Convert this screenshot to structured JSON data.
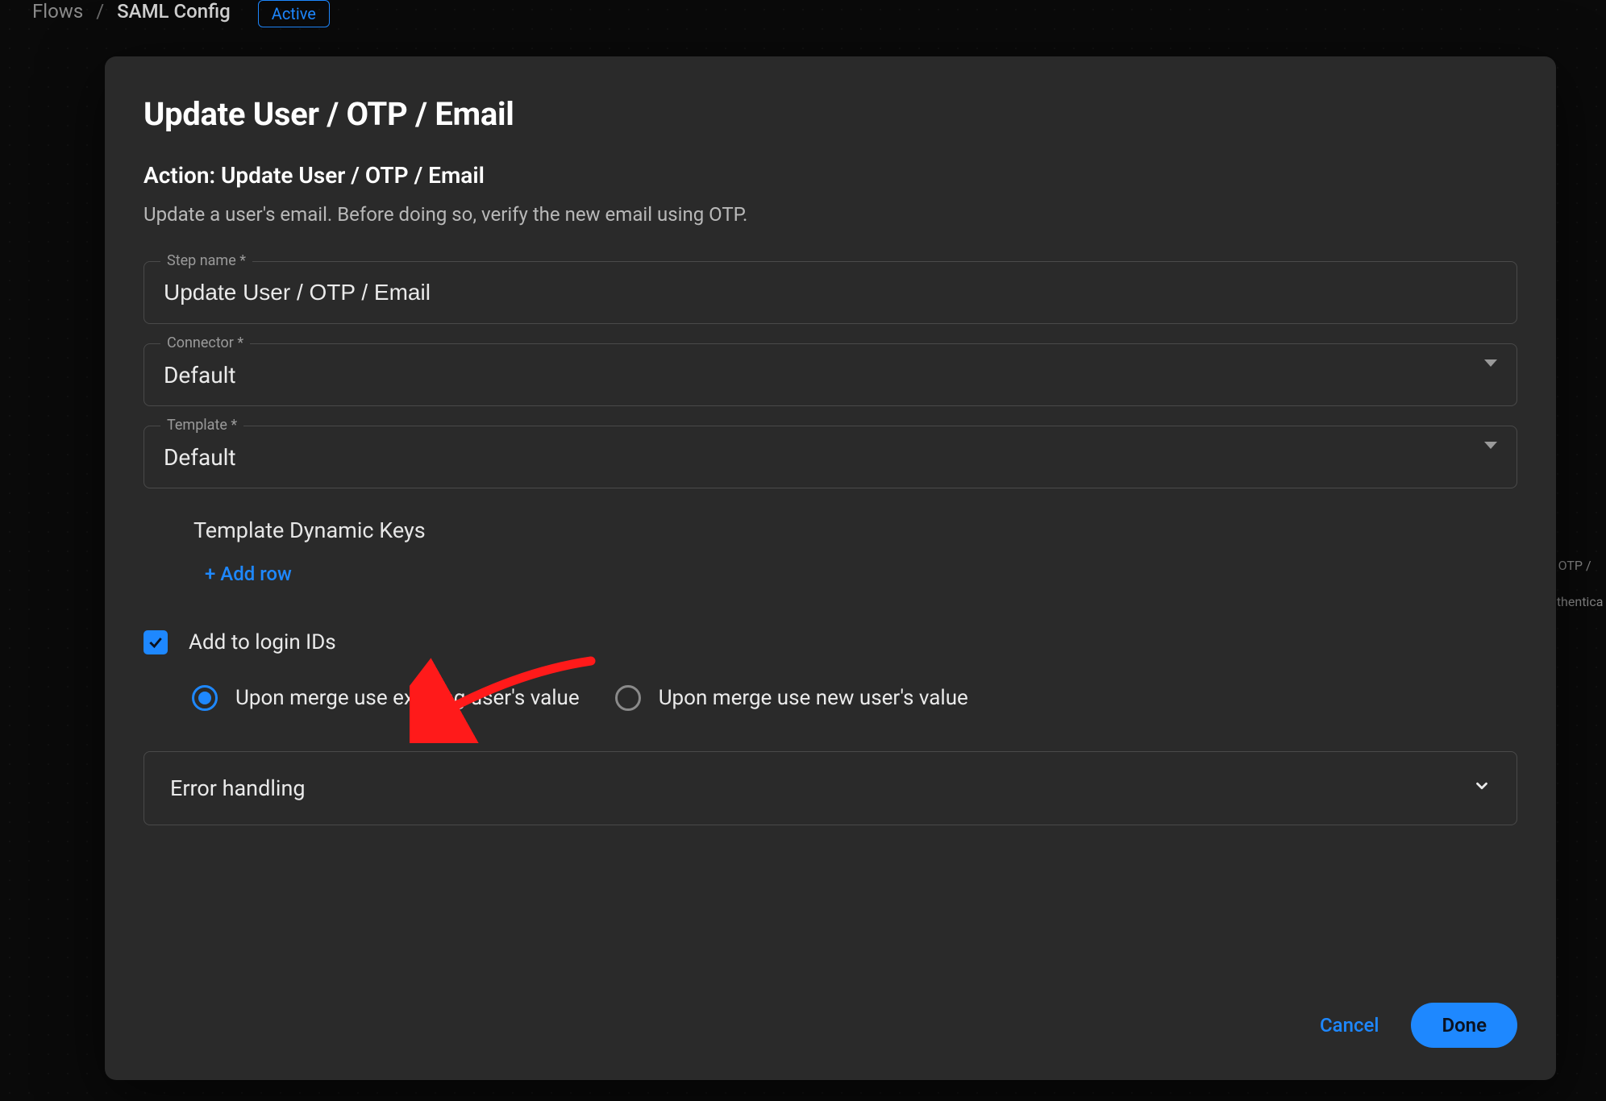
{
  "breadcrumb": {
    "root": "Flows",
    "current": "SAML Config",
    "badge": "Active"
  },
  "bg_hints": {
    "line1": "/ OTP /",
    "line2": "uthentica"
  },
  "modal": {
    "title": "Update User / OTP / Email",
    "subtitle": "Action: Update User / OTP / Email",
    "description": "Update a user's email. Before doing so, verify the new email using OTP.",
    "fields": {
      "step_name": {
        "label": "Step name *",
        "value": "Update User / OTP / Email"
      },
      "connector": {
        "label": "Connector *",
        "value": "Default"
      },
      "template": {
        "label": "Template *",
        "value": "Default"
      }
    },
    "dynamic_keys_header": "Template Dynamic Keys",
    "add_row_label": "+ Add row",
    "checkbox": {
      "label": "Add to login IDs",
      "checked": true
    },
    "radios": {
      "existing": "Upon merge use existing user's value",
      "new": "Upon merge use new user's value",
      "selected": "existing"
    },
    "error_handling_label": "Error handling",
    "buttons": {
      "cancel": "Cancel",
      "done": "Done"
    }
  }
}
